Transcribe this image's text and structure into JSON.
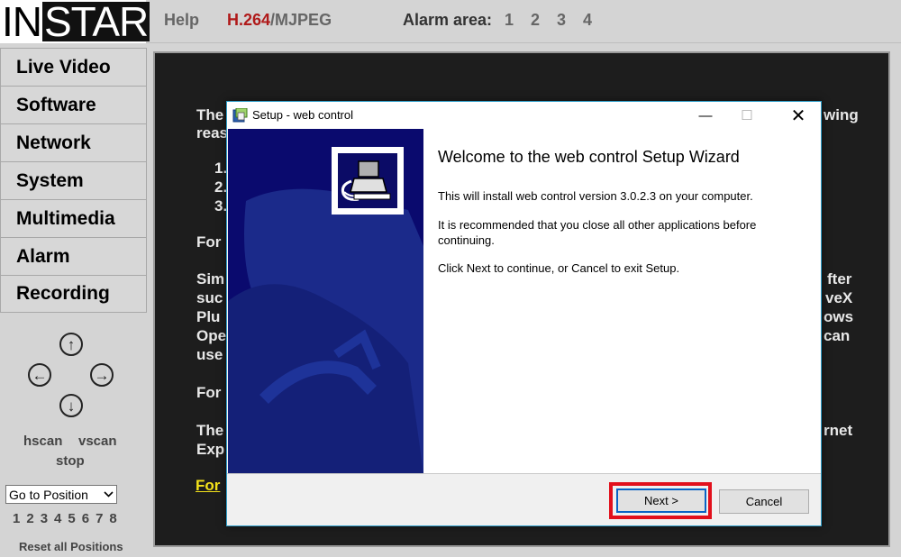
{
  "header": {
    "logo_in": "IN",
    "logo_star": "STAR",
    "help": "Help",
    "codec_h264": "H.264",
    "codec_rest": "/MJPEG",
    "alarm_label": "Alarm area:",
    "alarm_areas": [
      "1",
      "2",
      "3",
      "4"
    ]
  },
  "sidebar": {
    "items": [
      {
        "label": "Live Video"
      },
      {
        "label": "Software"
      },
      {
        "label": "Network"
      },
      {
        "label": "System"
      },
      {
        "label": "Multimedia"
      },
      {
        "label": "Alarm"
      },
      {
        "label": "Recording"
      }
    ],
    "ptz": {
      "up": "↑",
      "left": "←",
      "right": "→",
      "down": "↓"
    },
    "hscan": "hscan",
    "vscan": "vscan",
    "stop": "stop",
    "position_select": "Go to Position",
    "positions": [
      "1",
      "2",
      "3",
      "4",
      "5",
      "6",
      "7",
      "8"
    ],
    "reset": "Reset all Positions"
  },
  "background": {
    "left_fragments": [
      "The",
      "reas",
      "1.",
      "2.",
      "3.",
      "For",
      "Sim",
      "suc",
      "Plu",
      "Ope",
      "use",
      "For",
      "The",
      "Exp"
    ],
    "right_fragments": [
      "wing",
      "fter",
      "veX",
      "ows",
      "can",
      "rnet"
    ],
    "link": "For"
  },
  "dialog": {
    "title": "Setup - web control",
    "min": "—",
    "max": "☐",
    "close": "✕",
    "heading": "Welcome to the web control Setup Wizard",
    "para1": "This will install web control version 3.0.2.3 on your computer.",
    "para2": "It is recommended that you close all other applications before continuing.",
    "para3": "Click Next to continue, or Cancel to exit Setup.",
    "next": "Next >",
    "cancel": "Cancel"
  }
}
